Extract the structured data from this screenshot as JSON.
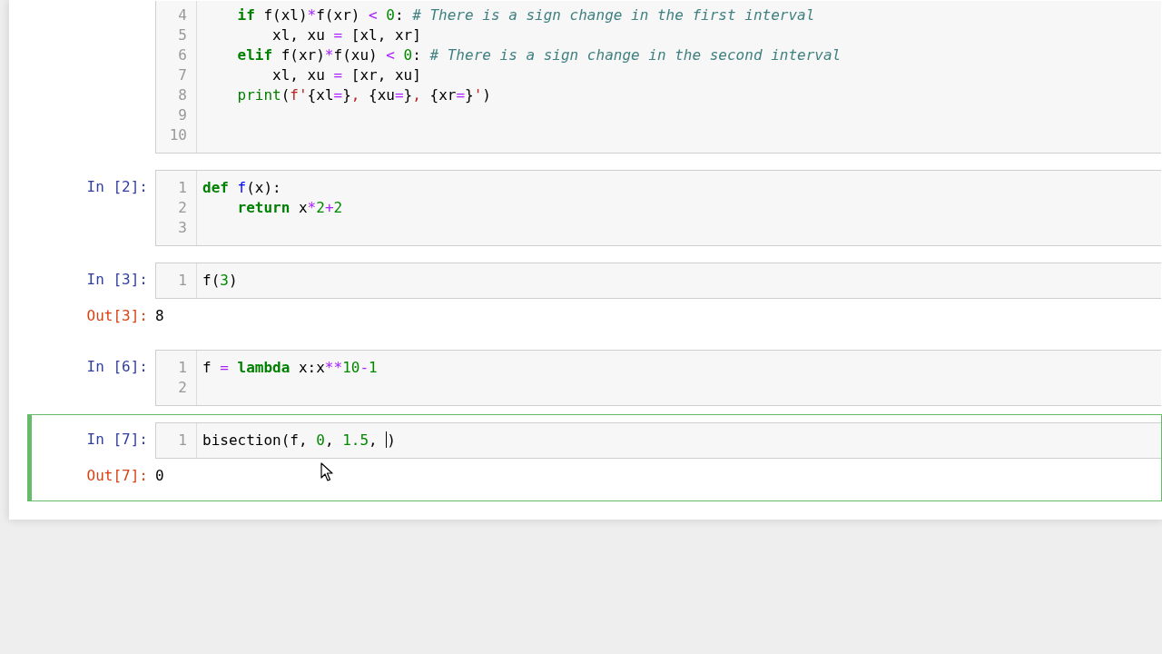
{
  "cells": [
    {
      "selected": false,
      "lines": [
        {
          "number": "4",
          "tokens": [
            {
              "kind": "kw",
              "t": "    if"
            },
            {
              "kind": "p",
              "t": " f(xl)"
            },
            {
              "kind": "op",
              "t": "*"
            },
            {
              "kind": "p",
              "t": "f(xr) "
            },
            {
              "kind": "op",
              "t": "< "
            },
            {
              "kind": "num",
              "t": "0"
            },
            {
              "kind": "p",
              "t": ": "
            },
            {
              "kind": "com",
              "t": "# There is a sign change in the first interval"
            }
          ]
        },
        {
          "number": "5",
          "tokens": [
            {
              "kind": "p",
              "t": "        xl, xu "
            },
            {
              "kind": "op",
              "t": "="
            },
            {
              "kind": "p",
              "t": " [xl, xr]"
            }
          ]
        },
        {
          "number": "6",
          "tokens": [
            {
              "kind": "kw",
              "t": "    elif"
            },
            {
              "kind": "p",
              "t": " f(xr)"
            },
            {
              "kind": "op",
              "t": "*"
            },
            {
              "kind": "p",
              "t": "f(xu) "
            },
            {
              "kind": "op",
              "t": "< "
            },
            {
              "kind": "num",
              "t": "0"
            },
            {
              "kind": "p",
              "t": ": "
            },
            {
              "kind": "com",
              "t": "# There is a sign change in the second interval"
            }
          ]
        },
        {
          "number": "7",
          "tokens": [
            {
              "kind": "p",
              "t": "        xl, xu "
            },
            {
              "kind": "op",
              "t": "="
            },
            {
              "kind": "p",
              "t": " [xr, xu]"
            }
          ]
        },
        {
          "number": "8",
          "tokens": [
            {
              "kind": "bi",
              "t": "    print"
            },
            {
              "kind": "p",
              "t": "("
            },
            {
              "kind": "str",
              "t": "f'"
            },
            {
              "kind": "p",
              "t": "{xl"
            },
            {
              "kind": "op",
              "t": "="
            },
            {
              "kind": "p",
              "t": "}"
            },
            {
              "kind": "str",
              "t": ", "
            },
            {
              "kind": "p",
              "t": "{xu"
            },
            {
              "kind": "op",
              "t": "="
            },
            {
              "kind": "p",
              "t": "}"
            },
            {
              "kind": "str",
              "t": ", "
            },
            {
              "kind": "p",
              "t": "{xr"
            },
            {
              "kind": "op",
              "t": "="
            },
            {
              "kind": "p",
              "t": "}"
            },
            {
              "kind": "str",
              "t": "'"
            },
            {
              "kind": "p",
              "t": ")"
            }
          ]
        },
        {
          "number": "9"
        },
        {
          "number": "10"
        }
      ]
    },
    {
      "prompt": "In [2]:",
      "selected": false,
      "lines": [
        {
          "number": "1",
          "tokens": [
            {
              "kind": "kw",
              "t": "def "
            },
            {
              "kind": "fn",
              "t": "f"
            },
            {
              "kind": "p",
              "t": "(x):"
            }
          ]
        },
        {
          "number": "2",
          "tokens": [
            {
              "kind": "kw",
              "t": "    return"
            },
            {
              "kind": "p",
              "t": " x"
            },
            {
              "kind": "op",
              "t": "*"
            },
            {
              "kind": "num",
              "t": "2"
            },
            {
              "kind": "op",
              "t": "+"
            },
            {
              "kind": "num",
              "t": "2"
            }
          ]
        },
        {
          "number": "3"
        }
      ]
    },
    {
      "prompt": "In [3]:",
      "selected": false,
      "lines": [
        {
          "number": "1",
          "tokens": [
            {
              "kind": "p",
              "t": "f("
            },
            {
              "kind": "num",
              "t": "3"
            },
            {
              "kind": "p",
              "t": ")"
            }
          ]
        }
      ],
      "output": {
        "prompt": "Out[3]:",
        "text": "8"
      }
    },
    {
      "prompt": "In [6]:",
      "selected": false,
      "lines": [
        {
          "number": "1",
          "tokens": [
            {
              "kind": "p",
              "t": "f "
            },
            {
              "kind": "op",
              "t": "= "
            },
            {
              "kind": "kw",
              "t": "lambda"
            },
            {
              "kind": "p",
              "t": " x:x"
            },
            {
              "kind": "op",
              "t": "**"
            },
            {
              "kind": "num",
              "t": "10"
            },
            {
              "kind": "op",
              "t": "-"
            },
            {
              "kind": "num",
              "t": "1"
            }
          ]
        },
        {
          "number": "2"
        }
      ]
    },
    {
      "prompt": "In [7]:",
      "selected": true,
      "lines": [
        {
          "number": "1",
          "tokens": [
            {
              "kind": "p",
              "t": "bisection(f, "
            },
            {
              "kind": "num",
              "t": "0"
            },
            {
              "kind": "p",
              "t": ", "
            },
            {
              "kind": "num",
              "t": "1.5"
            },
            {
              "kind": "p",
              "t": ", "
            },
            {
              "kind": "cursor"
            },
            {
              "kind": "p",
              "t": ")"
            }
          ]
        }
      ],
      "output": {
        "prompt": "Out[7]:",
        "text": "0"
      }
    }
  ]
}
